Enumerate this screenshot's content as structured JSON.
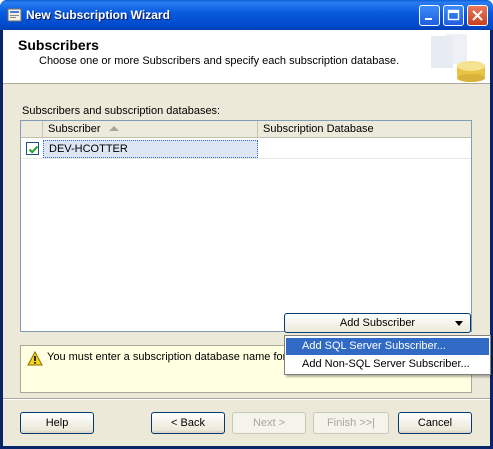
{
  "window": {
    "title": "New Subscription Wizard"
  },
  "header": {
    "title": "Subscribers",
    "subtitle": "Choose one or more Subscribers and specify each subscription database."
  },
  "grid": {
    "label": "Subscribers and subscription databases:",
    "columns": [
      "Subscriber",
      "Subscription Database"
    ],
    "sort_column": "Subscriber",
    "rows": [
      {
        "checked": true,
        "subscriber": "DEV-HCOTTER",
        "database": ""
      }
    ]
  },
  "add_subscriber": {
    "label": "Add Subscriber",
    "menu": [
      {
        "label": "Add SQL Server Subscriber...",
        "highlighted": true
      },
      {
        "label": "Add Non-SQL Server Subscriber...",
        "highlighted": false
      }
    ]
  },
  "message": {
    "icon": "warning-icon",
    "text": "You must enter a subscription database name for S"
  },
  "buttons": {
    "help": "Help",
    "back": "< Back",
    "next": "Next >",
    "finish": "Finish >>|",
    "cancel": "Cancel"
  },
  "colors": {
    "titlebar": "#0054e3",
    "selection": "#316ac5",
    "dialog_bg": "#ece9d8",
    "message_bg": "#ffffe1"
  }
}
